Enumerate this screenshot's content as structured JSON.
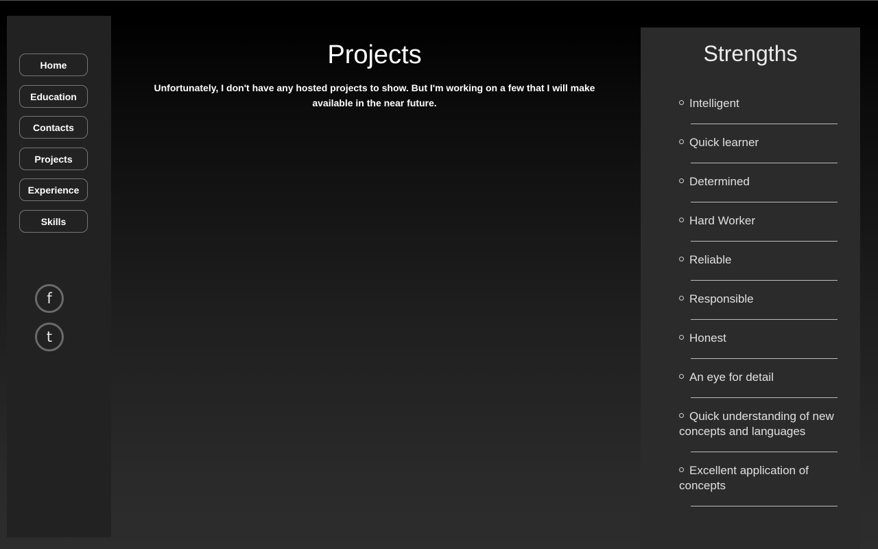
{
  "nav": {
    "items": [
      {
        "label": "Home"
      },
      {
        "label": "Education"
      },
      {
        "label": "Contacts"
      },
      {
        "label": "Projects"
      },
      {
        "label": "Experience"
      },
      {
        "label": "Skills"
      }
    ]
  },
  "social": {
    "facebook": "f",
    "twitter": "t"
  },
  "main": {
    "title": "Projects",
    "text": "Unfortunately, I don't have any hosted projects to show. But I'm working on a few that I will make available in the near future."
  },
  "strengths": {
    "title": "Strengths",
    "items": [
      "Intelligent",
      "Quick learner",
      "Determined",
      "Hard Worker",
      "Reliable",
      "Responsible",
      "Honest",
      "An eye for detail",
      "Quick understanding of new concepts and languages",
      "Excellent application of concepts"
    ]
  },
  "colors": {
    "sidebar_bg": "#222222",
    "right_panel_bg": "#2b2b2b",
    "text": "#ffffff"
  }
}
